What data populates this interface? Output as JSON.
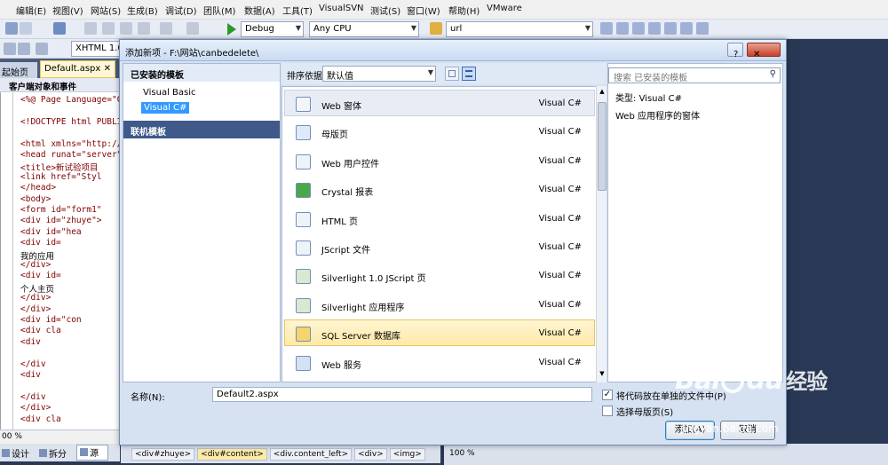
{
  "menubar": {
    "items": [
      "编辑(E)",
      "视图(V)",
      "网站(S)",
      "生成(B)",
      "调试(D)",
      "团队(M)",
      "数据(A)",
      "工具(T)",
      "VisualSVN",
      "测试(S)",
      "窗口(W)",
      "帮助(H)",
      "VMware"
    ]
  },
  "toolbar": {
    "config": "Debug",
    "platform": "Any CPU",
    "find": "url",
    "doctype": "XHTML 1.0"
  },
  "tabs": {
    "start": "起始页",
    "file": "Default.aspx"
  },
  "editor": {
    "header": "客户端对象和事件",
    "lines": [
      "<%@ Page Language=\"C",
      "",
      "<!DOCTYPE html PUBLI",
      "",
      "<html xmlns=\"http://",
      "<head runat=\"server\"",
      "    <title>新试验项目",
      "    <link href=\"Styl",
      "</head>",
      "<body>",
      "    <form id=\"form1\"",
      "    <div id=\"zhuye\">",
      "        <div id=\"hea",
      "            <div id=",
      "            我的应用",
      "            </div>",
      "            <div id=",
      "            个人主页",
      "            </div>",
      "        </div>",
      "        <div id=\"con",
      "            <div cla",
      "                <div",
      "",
      "                </div",
      "                <div",
      "",
      "                </div",
      "        </div>",
      "        <div cla"
    ]
  },
  "status": {
    "zoom": "00 %",
    "design": "设计",
    "split": "拆分",
    "source": "源",
    "zoom2": "100 %",
    "breadcrumbs": [
      "<div#zhuye>",
      "<div#content>",
      "<div.content_left>",
      "<div>",
      "<img>"
    ]
  },
  "dialog": {
    "title": "添加新项 - F:\\网站\\canbedelete\\",
    "installed_header": "已安装的模板",
    "languages": [
      "Visual Basic",
      "Visual C#"
    ],
    "online_header": "联机模板",
    "sort_label": "排序依据:",
    "sort_value": "默认值",
    "search_placeholder": "搜索 已安装的模板",
    "items": [
      {
        "name": "Web 窗体",
        "lang": "Visual C#"
      },
      {
        "name": "母版页",
        "lang": "Visual C#"
      },
      {
        "name": "Web 用户控件",
        "lang": "Visual C#"
      },
      {
        "name": "Crystal 报表",
        "lang": "Visual C#"
      },
      {
        "name": "HTML 页",
        "lang": "Visual C#"
      },
      {
        "name": "JScript 文件",
        "lang": "Visual C#"
      },
      {
        "name": "Silverlight 1.0 JScript 页",
        "lang": "Visual C#"
      },
      {
        "name": "Silverlight 应用程序",
        "lang": "Visual C#"
      },
      {
        "name": "SQL Server 数据库",
        "lang": "Visual C#"
      },
      {
        "name": "Web 服务",
        "lang": "Visual C#"
      }
    ],
    "type_label": "类型:",
    "type_value": "Visual C#",
    "description": "Web 应用程序的窗体",
    "name_label": "名称(N):",
    "name_value": "Default2.aspx",
    "separate_code_label": "将代码放在单独的文件中(P)",
    "select_master_label": "选择母版页(S)",
    "add_button": "添加(A)",
    "cancel_button": "取消"
  },
  "watermark": {
    "brand": "Bai",
    "brand2": "du",
    "suffix": "经验",
    "url": "jingyan.baidu.com"
  },
  "colors": {
    "accent": "#3399ff",
    "selected_hover": "#fde9a8",
    "ide_dark": "#293955"
  }
}
